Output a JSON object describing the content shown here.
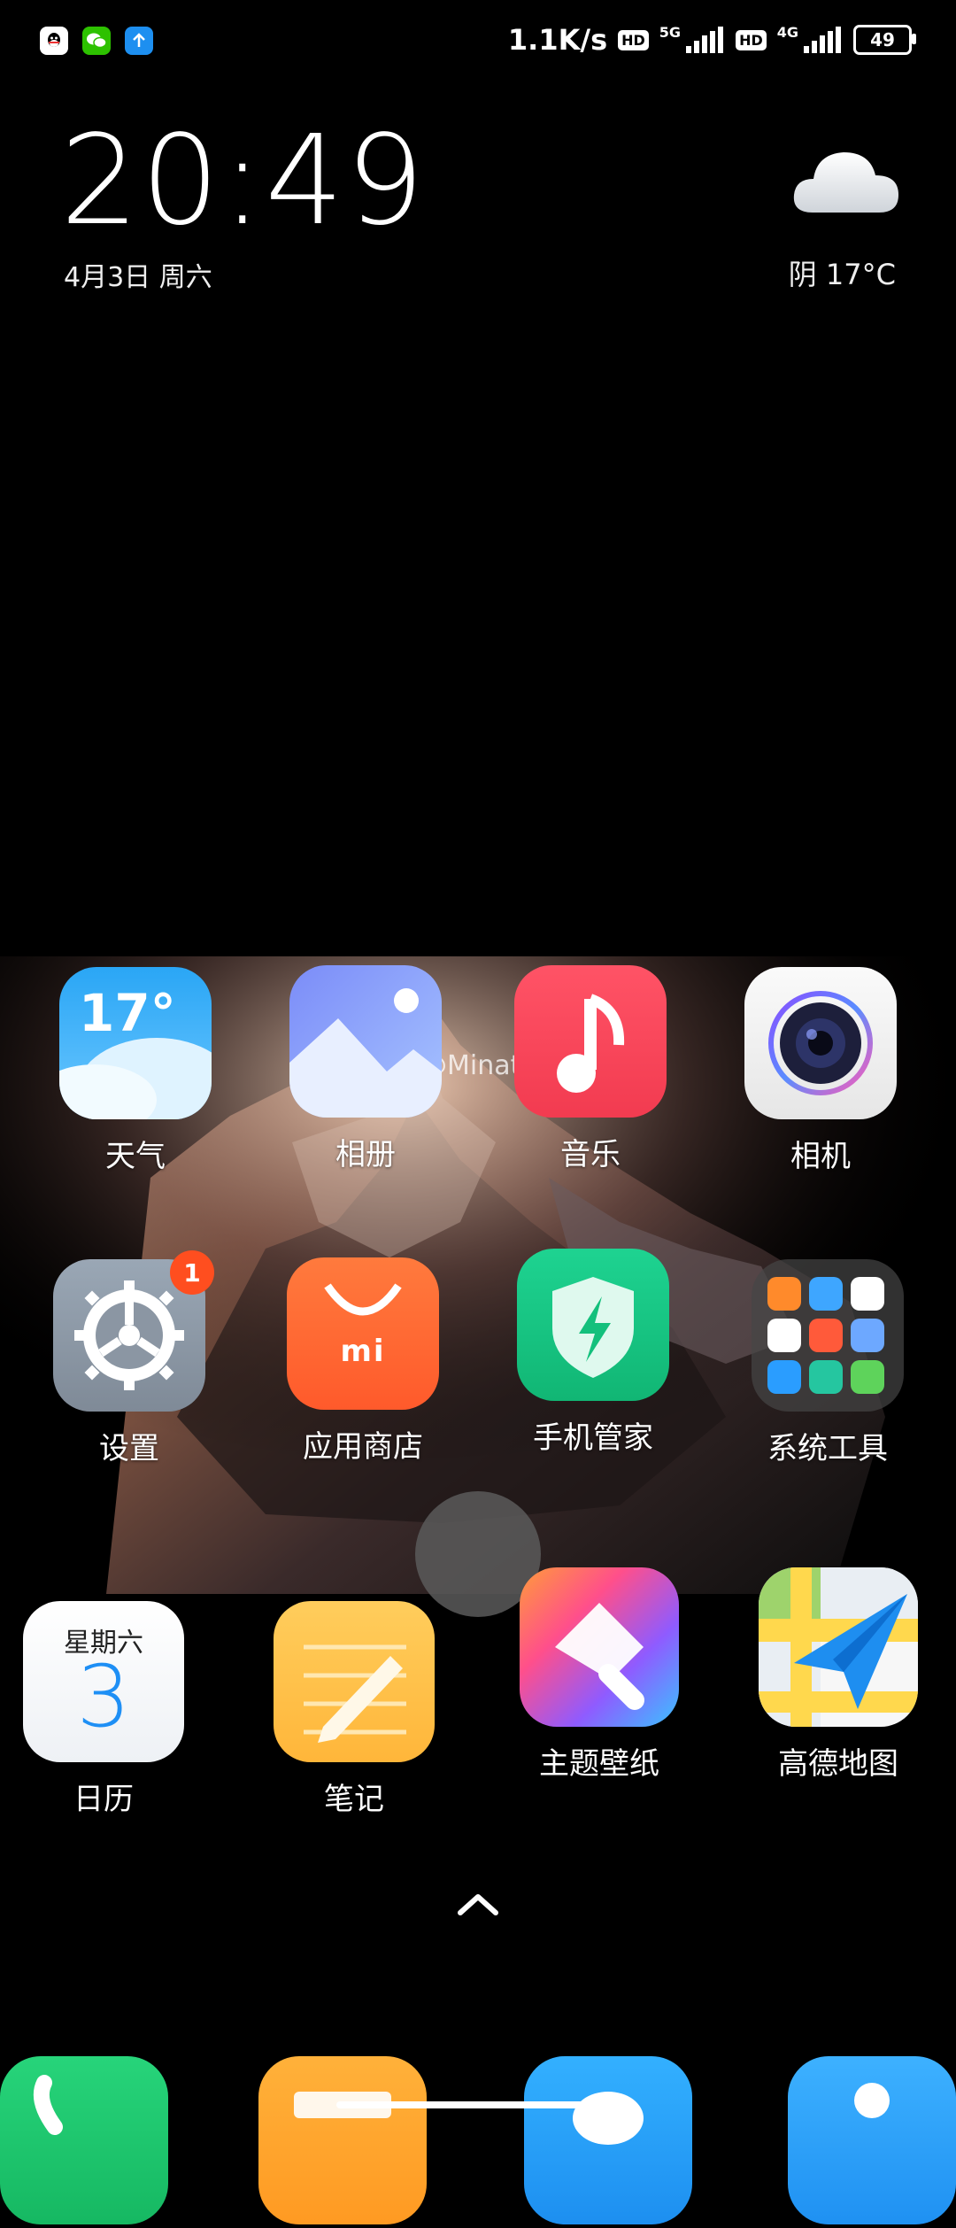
{
  "status_bar": {
    "net_speed": "1.1K/s",
    "hd1": "HD",
    "net1": "5G",
    "hd2": "HD",
    "net2": "4G",
    "battery": "49"
  },
  "clock_widget": {
    "time": "20:49",
    "date": "4月3日 周六",
    "weather": "阴  17°C"
  },
  "apps": {
    "weather": {
      "label": "天气",
      "icon_text": "17°"
    },
    "gallery": {
      "label": "相册"
    },
    "music": {
      "label": "音乐"
    },
    "camera": {
      "label": "相机"
    },
    "settings": {
      "label": "设置",
      "badge": "1"
    },
    "app_store": {
      "label": "应用商店",
      "icon_text": "mi"
    },
    "security": {
      "label": "手机管家"
    },
    "system_tools": {
      "label": "系统工具"
    },
    "calendar": {
      "label": "日历",
      "weekday": "星期六",
      "day": "3"
    },
    "notes": {
      "label": "笔记"
    },
    "themes": {
      "label": "主题壁纸"
    },
    "amap": {
      "label": "高德地图"
    }
  },
  "watermark": "酷安@MinatoXeon",
  "colors": {
    "weather_top": "#2aa6f5",
    "music": "#f3425a",
    "app_store": "#ff6c35",
    "security": "#16c785",
    "notes": "#ffc24a",
    "badge": "#ff4e1f"
  }
}
